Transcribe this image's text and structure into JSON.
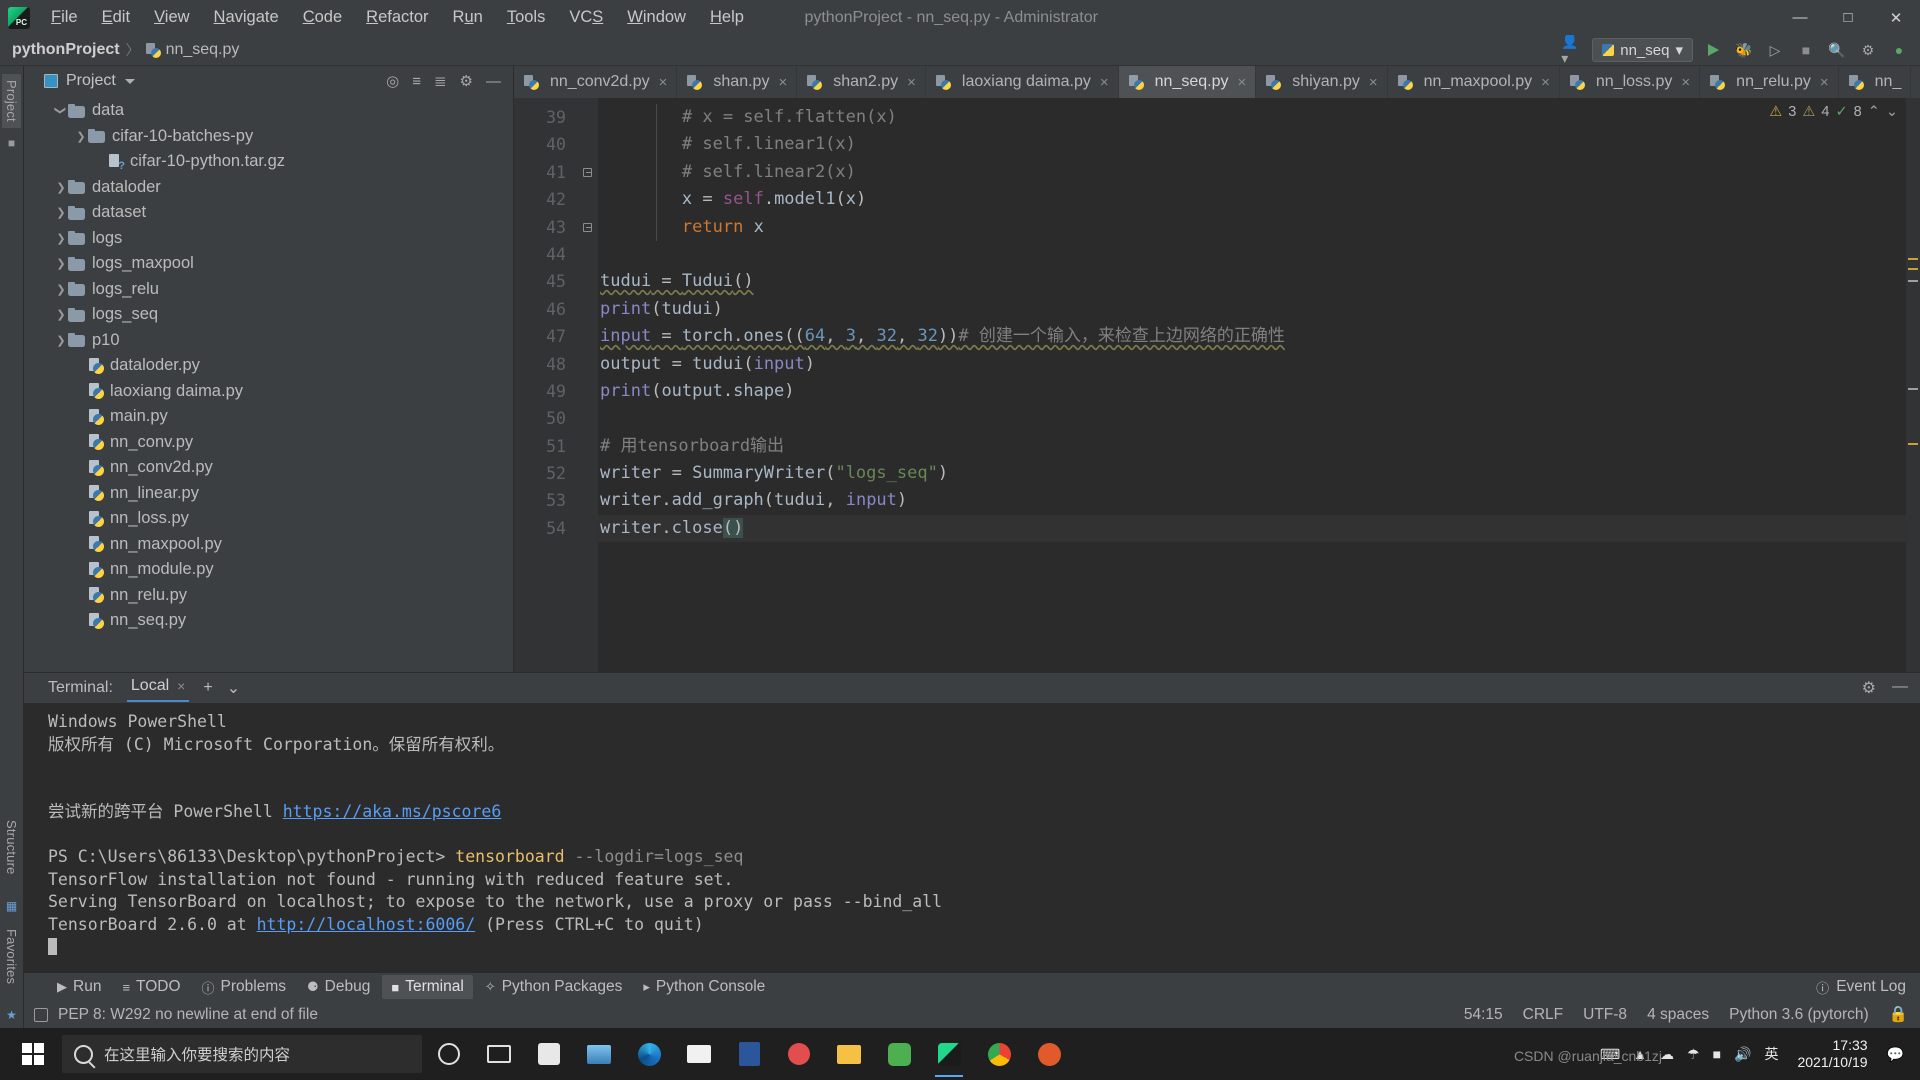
{
  "window": {
    "title": "pythonProject - nn_seq.py - Administrator",
    "minimize": "—",
    "maximize": "□",
    "close": "✕"
  },
  "menu": [
    {
      "label": "File"
    },
    {
      "label": "Edit"
    },
    {
      "label": "View"
    },
    {
      "label": "Navigate"
    },
    {
      "label": "Code"
    },
    {
      "label": "Refactor"
    },
    {
      "label": "Run"
    },
    {
      "label": "Tools"
    },
    {
      "label": "VCS"
    },
    {
      "label": "Window"
    },
    {
      "label": "Help"
    }
  ],
  "navbar": {
    "project": "pythonProject",
    "separator": "〉",
    "file": "nn_seq.py",
    "run_config": "nn_seq",
    "caret": "▾"
  },
  "rail": {
    "project_label": "Project",
    "structure_label": "Structure",
    "favorites_label": "Favorites"
  },
  "project_pane": {
    "title": "Project",
    "tree": [
      {
        "indent": 1,
        "arrow": "down",
        "type": "folder",
        "label": "data"
      },
      {
        "indent": 2,
        "arrow": "right",
        "type": "folder",
        "label": "cifar-10-batches-py"
      },
      {
        "indent": 3,
        "arrow": "none",
        "type": "archive",
        "label": "cifar-10-python.tar.gz"
      },
      {
        "indent": 1,
        "arrow": "right",
        "type": "folder",
        "label": "dataloder"
      },
      {
        "indent": 1,
        "arrow": "right",
        "type": "folder",
        "label": "dataset"
      },
      {
        "indent": 1,
        "arrow": "right",
        "type": "folder",
        "label": "logs"
      },
      {
        "indent": 1,
        "arrow": "right",
        "type": "folder",
        "label": "logs_maxpool"
      },
      {
        "indent": 1,
        "arrow": "right",
        "type": "folder",
        "label": "logs_relu"
      },
      {
        "indent": 1,
        "arrow": "right",
        "type": "folder",
        "label": "logs_seq"
      },
      {
        "indent": 1,
        "arrow": "right",
        "type": "folder",
        "label": "p10"
      },
      {
        "indent": 2,
        "arrow": "none",
        "type": "python",
        "label": "dataloder.py"
      },
      {
        "indent": 2,
        "arrow": "none",
        "type": "python",
        "label": "laoxiang daima.py"
      },
      {
        "indent": 2,
        "arrow": "none",
        "type": "python",
        "label": "main.py"
      },
      {
        "indent": 2,
        "arrow": "none",
        "type": "python",
        "label": "nn_conv.py"
      },
      {
        "indent": 2,
        "arrow": "none",
        "type": "python",
        "label": "nn_conv2d.py"
      },
      {
        "indent": 2,
        "arrow": "none",
        "type": "python",
        "label": "nn_linear.py"
      },
      {
        "indent": 2,
        "arrow": "none",
        "type": "python",
        "label": "nn_loss.py"
      },
      {
        "indent": 2,
        "arrow": "none",
        "type": "python",
        "label": "nn_maxpool.py"
      },
      {
        "indent": 2,
        "arrow": "none",
        "type": "python",
        "label": "nn_module.py"
      },
      {
        "indent": 2,
        "arrow": "none",
        "type": "python",
        "label": "nn_relu.py"
      },
      {
        "indent": 2,
        "arrow": "none",
        "type": "python",
        "label": "nn_seq.py"
      }
    ]
  },
  "tabs": [
    {
      "label": "nn_conv2d.py",
      "active": false
    },
    {
      "label": "shan.py",
      "active": false
    },
    {
      "label": "shan2.py",
      "active": false
    },
    {
      "label": "laoxiang daima.py",
      "active": false
    },
    {
      "label": "nn_seq.py",
      "active": true
    },
    {
      "label": "shiyan.py",
      "active": false
    },
    {
      "label": "nn_maxpool.py",
      "active": false
    },
    {
      "label": "nn_loss.py",
      "active": false
    },
    {
      "label": "nn_relu.py",
      "active": false
    },
    {
      "label": "nn_",
      "active": false
    }
  ],
  "inspection": {
    "warnings": "3",
    "weak_warnings": "4",
    "typos": "8",
    "warn_icon": "⚠",
    "weak_icon": "⚠",
    "ok_icon": "✓",
    "caret_up": "⌃",
    "caret_down": "⌄"
  },
  "editor": {
    "first_line": 39,
    "lines": [
      {
        "n": 39,
        "fold": false,
        "indent": 2,
        "text": "# x = self.flatten(x)"
      },
      {
        "n": 40,
        "fold": false,
        "indent": 2,
        "text": "# self.linear1(x)"
      },
      {
        "n": 41,
        "fold": true,
        "indent": 2,
        "text": "# self.linear2(x)"
      },
      {
        "n": 42,
        "fold": false,
        "indent": 2,
        "text": "x = self.model1(x)"
      },
      {
        "n": 43,
        "fold": true,
        "indent": 2,
        "text": "return x"
      },
      {
        "n": 44,
        "fold": false,
        "indent": 0,
        "text": ""
      },
      {
        "n": 45,
        "fold": false,
        "indent": 0,
        "text": "tudui = Tudui()"
      },
      {
        "n": 46,
        "fold": false,
        "indent": 0,
        "text": "print(tudui)"
      },
      {
        "n": 47,
        "fold": false,
        "indent": 0,
        "text": "input = torch.ones((64, 3, 32, 32))# 创建一个输入，来检查上边网络的正确性"
      },
      {
        "n": 48,
        "fold": false,
        "indent": 0,
        "text": "output = tudui(input)"
      },
      {
        "n": 49,
        "fold": false,
        "indent": 0,
        "text": "print(output.shape)"
      },
      {
        "n": 50,
        "fold": false,
        "indent": 0,
        "text": ""
      },
      {
        "n": 51,
        "fold": false,
        "indent": 0,
        "text": "# 用tensorboard输出"
      },
      {
        "n": 52,
        "fold": false,
        "indent": 0,
        "text": "writer = SummaryWriter(\"logs_seq\")"
      },
      {
        "n": 53,
        "fold": false,
        "indent": 0,
        "text": "writer.add_graph(tudui, input)"
      },
      {
        "n": 54,
        "fold": false,
        "indent": 0,
        "text": "writer.close()"
      }
    ]
  },
  "terminal": {
    "label": "Terminal:",
    "tab": "Local",
    "close": "×",
    "add": "+",
    "dropdown": "⌄",
    "settings_icon": "gear",
    "minimize_icon": "—",
    "lines": [
      {
        "text": "Windows PowerShell"
      },
      {
        "text": "版权所有 (C) Microsoft Corporation。保留所有权利。"
      },
      {
        "text": ""
      },
      {
        "text": ""
      },
      {
        "text": "尝试新的跨平台 PowerShell ",
        "link": "https://aka.ms/pscore6"
      },
      {
        "text": ""
      },
      {
        "prompt": "PS C:\\Users\\86133\\Desktop\\pythonProject> ",
        "cmd": "tensorboard",
        "args": " --logdir=logs_seq"
      },
      {
        "text": "TensorFlow installation not found - running with reduced feature set."
      },
      {
        "text": "Serving TensorBoard on localhost; to expose to the network, use a proxy or pass --bind_all"
      },
      {
        "text": "TensorBoard 2.6.0 at ",
        "link": "http://localhost:6006/",
        "tail": " (Press CTRL+C to quit)"
      },
      {
        "cursor": true
      }
    ]
  },
  "toolstrip": {
    "items": [
      {
        "label": "Run",
        "icon": "▶",
        "selected": false
      },
      {
        "label": "TODO",
        "icon": "≡",
        "selected": false
      },
      {
        "label": "Problems",
        "icon": "ⓘ",
        "selected": false
      },
      {
        "label": "Debug",
        "icon": "⚈",
        "selected": false
      },
      {
        "label": "Terminal",
        "icon": "■",
        "selected": true
      },
      {
        "label": "Python Packages",
        "icon": "✧",
        "selected": false
      },
      {
        "label": "Python Console",
        "icon": "▸",
        "selected": false
      }
    ],
    "event_log": "Event Log",
    "event_icon": "ⓘ"
  },
  "statusbar": {
    "message": "PEP 8: W292 no newline at end of file",
    "caret": "54:15",
    "line_sep": "CRLF",
    "encoding": "UTF-8",
    "indent": "4 spaces",
    "interpreter": "Python 3.6 (pytorch)",
    "lock_icon": "🔒"
  },
  "taskbar": {
    "search_placeholder": "在这里输入你要搜索的内容",
    "time": "17:33",
    "date": "2021/10/19",
    "ime": "英",
    "watermark": "CSDN @ruanjia_cnb1zj",
    "apps": [
      {
        "name": "cortana"
      },
      {
        "name": "task-view"
      },
      {
        "name": "store"
      },
      {
        "name": "file-explorer-blue"
      },
      {
        "name": "edge"
      },
      {
        "name": "mail"
      },
      {
        "name": "word"
      },
      {
        "name": "snip"
      },
      {
        "name": "folder"
      },
      {
        "name": "wechat"
      },
      {
        "name": "pycharm"
      },
      {
        "name": "chrome"
      },
      {
        "name": "qq"
      }
    ]
  }
}
